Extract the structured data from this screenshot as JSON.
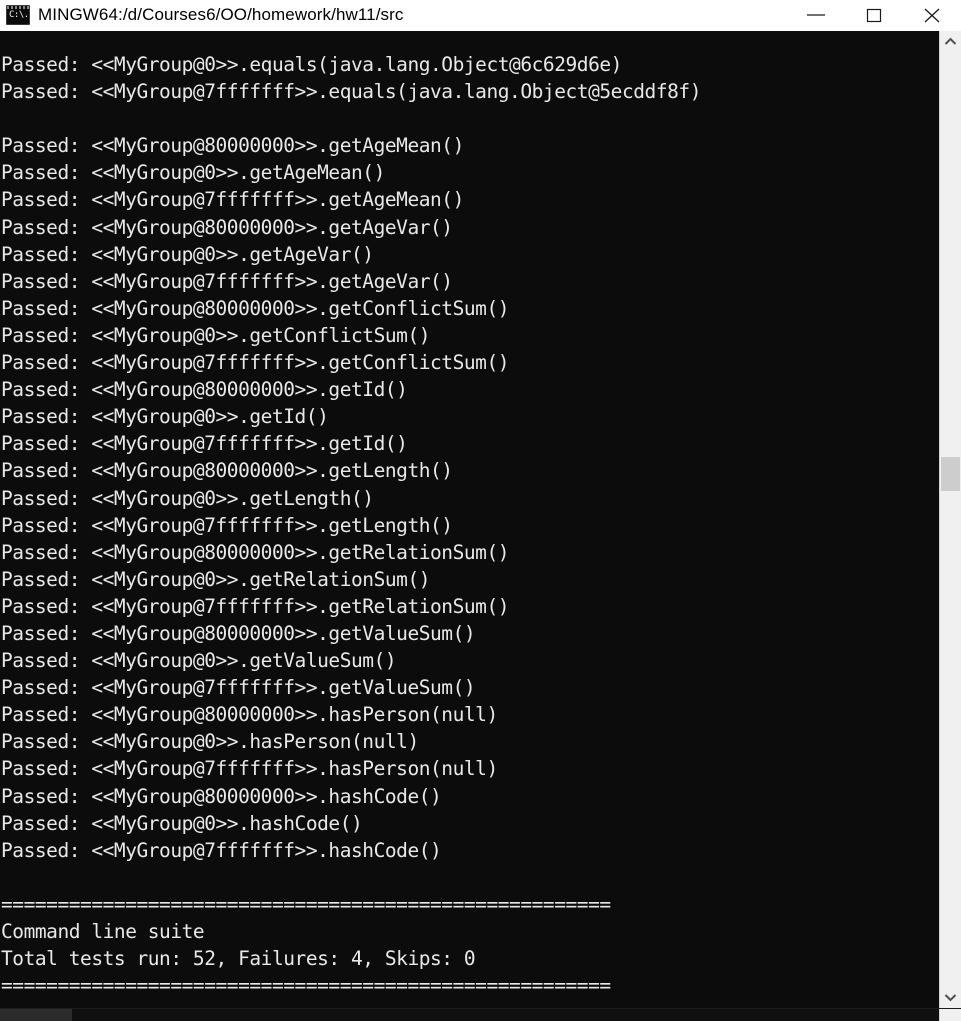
{
  "window": {
    "title": "MINGW64:/d/Courses6/OO/homework/hw11/src",
    "icon": "console-icon",
    "icon_glyph": "C:\\.",
    "controls": {
      "minimize_label": "Minimize",
      "maximize_label": "Maximize",
      "close_label": "Close"
    },
    "colors": {
      "titlebar_background": "#ffffff",
      "titlebar_text": "#000000",
      "console_background": "#0c0c0c",
      "console_text": "#e8e8e8",
      "scrollbar_track": "#f0f0f0",
      "scrollbar_thumb": "#cdcdcd"
    }
  },
  "scrollbars": {
    "vertical": {
      "up_arrow": "chevron-up-icon",
      "down_arrow": "chevron-down-icon",
      "thumb_position_percent": 45
    },
    "horizontal": {
      "thumb_position_percent": 0
    }
  },
  "console": {
    "lines": [
      "Passed: <<MyGroup@0>>.equals(java.lang.Object@6c629d6e)",
      "Passed: <<MyGroup@7fffffff>>.equals(java.lang.Object@5ecddf8f)",
      "",
      "Passed: <<MyGroup@80000000>>.getAgeMean()",
      "Passed: <<MyGroup@0>>.getAgeMean()",
      "Passed: <<MyGroup@7fffffff>>.getAgeMean()",
      "Passed: <<MyGroup@80000000>>.getAgeVar()",
      "Passed: <<MyGroup@0>>.getAgeVar()",
      "Passed: <<MyGroup@7fffffff>>.getAgeVar()",
      "Passed: <<MyGroup@80000000>>.getConflictSum()",
      "Passed: <<MyGroup@0>>.getConflictSum()",
      "Passed: <<MyGroup@7fffffff>>.getConflictSum()",
      "Passed: <<MyGroup@80000000>>.getId()",
      "Passed: <<MyGroup@0>>.getId()",
      "Passed: <<MyGroup@7fffffff>>.getId()",
      "Passed: <<MyGroup@80000000>>.getLength()",
      "Passed: <<MyGroup@0>>.getLength()",
      "Passed: <<MyGroup@7fffffff>>.getLength()",
      "Passed: <<MyGroup@80000000>>.getRelationSum()",
      "Passed: <<MyGroup@0>>.getRelationSum()",
      "Passed: <<MyGroup@7fffffff>>.getRelationSum()",
      "Passed: <<MyGroup@80000000>>.getValueSum()",
      "Passed: <<MyGroup@0>>.getValueSum()",
      "Passed: <<MyGroup@7fffffff>>.getValueSum()",
      "Passed: <<MyGroup@80000000>>.hasPerson(null)",
      "Passed: <<MyGroup@0>>.hasPerson(null)",
      "Passed: <<MyGroup@7fffffff>>.hasPerson(null)",
      "Passed: <<MyGroup@80000000>>.hashCode()",
      "Passed: <<MyGroup@0>>.hashCode()",
      "Passed: <<MyGroup@7fffffff>>.hashCode()",
      "",
      "======================================================",
      "Command line suite",
      "Total tests run: 52, Failures: 4, Skips: 0",
      "======================================================"
    ],
    "summary": {
      "suite_name": "Command line suite",
      "total_tests_run": 52,
      "failures": 4,
      "skips": 0,
      "separator": "======================================================"
    }
  }
}
